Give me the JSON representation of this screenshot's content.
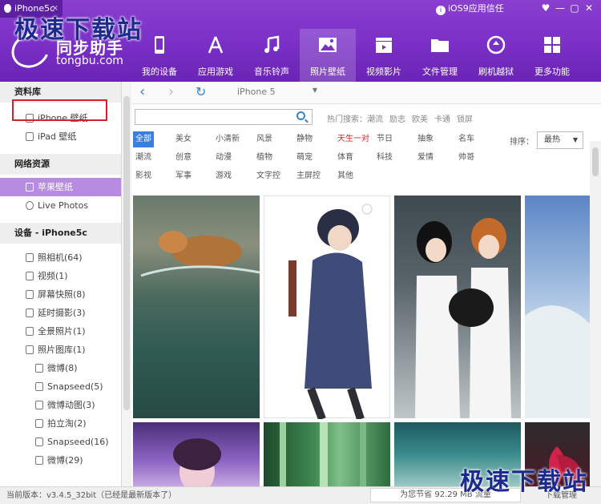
{
  "header": {
    "device_tab": "iPhone5c",
    "trust_label": "iOS9应用信任",
    "logo_title": "同步助手",
    "logo_sub": "tongbu.com",
    "window_buttons": [
      "♥",
      "—",
      "▢",
      "✕"
    ]
  },
  "nav": [
    {
      "label": "我的设备",
      "icon": "phone-icon"
    },
    {
      "label": "应用游戏",
      "icon": "app-store-icon"
    },
    {
      "label": "音乐铃声",
      "icon": "music-note-icon"
    },
    {
      "label": "照片壁纸",
      "icon": "picture-icon",
      "active": true
    },
    {
      "label": "视频影片",
      "icon": "clapper-icon"
    },
    {
      "label": "文件管理",
      "icon": "folder-icon"
    },
    {
      "label": "刷机越狱",
      "icon": "refresh-circle-icon"
    },
    {
      "label": "更多功能",
      "icon": "grid-icon"
    }
  ],
  "sidebar": {
    "library_header": "资料库",
    "library_items": [
      "iPhone 壁纸",
      "iPad 壁纸"
    ],
    "network_header": "网络资源",
    "network_items": [
      "苹果壁纸",
      "Live Photos"
    ],
    "device_header": "设备 - iPhone5c",
    "device_items": [
      "照相机(64)",
      "视频(1)",
      "屏幕快照(8)",
      "延时摄影(3)",
      "全景照片(1)",
      "照片图库(1)"
    ],
    "gallery_items": [
      "微博(8)",
      "Snapseed(5)",
      "微博动图(3)",
      "拍立淘(2)",
      "Snapseed(16)",
      "微博(29)"
    ]
  },
  "toolbar": {
    "back": "‹",
    "forward": "›",
    "refresh": "↻",
    "device": "iPhone 5",
    "caret": "▼"
  },
  "search": {
    "value": "",
    "hot_label": "热门搜索：",
    "hot_terms": [
      "潮流",
      "励志",
      "欧美",
      "卡通",
      "锁屏"
    ]
  },
  "categories": [
    [
      "全部",
      "美女",
      "小清新",
      "风景",
      "静物",
      "天生一对",
      "节日",
      "抽象",
      "名车"
    ],
    [
      "潮流",
      "创意",
      "动漫",
      "植物",
      "萌宠",
      "体育",
      "科技",
      "爱情",
      "帅哥"
    ],
    [
      "影视",
      "军事",
      "游戏",
      "文字控",
      "主屏控",
      "其他"
    ]
  ],
  "sort": {
    "label": "排序：",
    "value": "最热",
    "caret": "▼"
  },
  "status": {
    "version": "当前版本：v3.4.5_32bit（已经是最新版本了）",
    "save": "为您节省  92.29 MB 流量",
    "download": "下载管理"
  },
  "watermark": "极速下载站",
  "colors": {
    "accent": "#7a2fc6",
    "selected": "#b68be0",
    "blue": "#3a7ee0",
    "red": "#d9202a"
  }
}
